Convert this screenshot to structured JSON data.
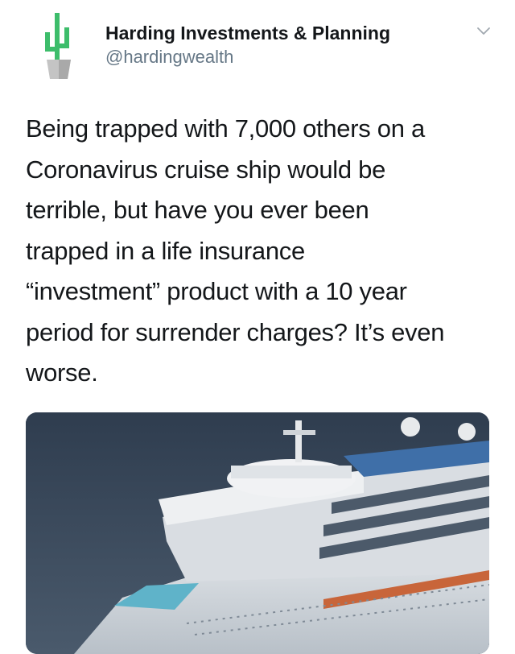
{
  "tweet": {
    "display_name": "Harding Investments & Planning",
    "handle": "@hardingwealth",
    "text": "Being trapped with 7,000 others on a\nCoronavirus cruise ship would be\nterrible, but have you ever been\ntrapped in a life insurance\n“investment” product with a 10 year\nperiod for surrender charges? It’s even\nworse.",
    "avatar_icon": "cactus-in-pot-icon",
    "menu_icon": "chevron-down-icon",
    "media_description_icon": "cruise-ship-image"
  },
  "colors": {
    "text_primary": "#14171a",
    "text_secondary": "#657786",
    "cactus_green": "#3dbd6b",
    "pot_gray": "#b9b9b9",
    "sea_blue": "#3b4a5c"
  }
}
